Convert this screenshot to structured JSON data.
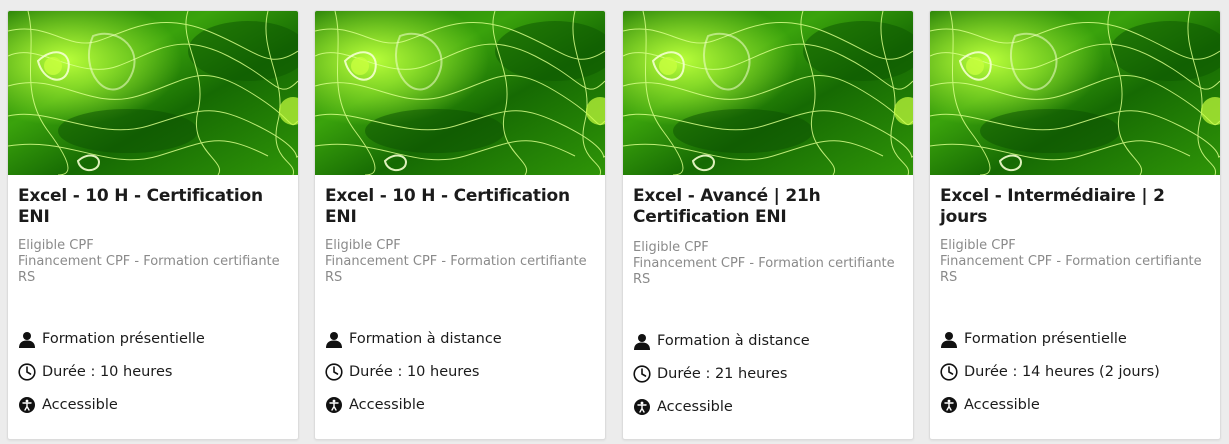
{
  "accent_green": "#4caf10",
  "cards": [
    {
      "title": "Excel - 10 H - Certification ENI",
      "desc": [
        "Eligible CPF",
        "Financement CPF - Formation certifiante",
        "RS"
      ],
      "mode": "Formation présentielle",
      "mode_icon": "person-icon",
      "duration": "Durée : 10 heures",
      "accessible": "Accessible"
    },
    {
      "title": "Excel - 10 H - Certification ENI",
      "desc": [
        "Eligible CPF",
        "Financement CPF - Formation certifiante",
        "RS"
      ],
      "mode": "Formation à distance",
      "mode_icon": "person-icon",
      "duration": "Durée : 10 heures",
      "accessible": "Accessible"
    },
    {
      "title": "Excel - Avancé | 21h Certification ENI",
      "desc": [
        "Eligible CPF",
        "Financement CPF - Formation certifiante",
        "RS"
      ],
      "mode": "Formation à distance",
      "mode_icon": "person-icon",
      "duration": "Durée : 21 heures",
      "accessible": "Accessible"
    },
    {
      "title": "Excel - Intermédiaire | 2 jours",
      "desc": [
        "Eligible CPF",
        "Financement CPF - Formation certifiante",
        "RS"
      ],
      "mode": "Formation présentielle",
      "mode_icon": "person-icon",
      "duration": "Durée : 14 heures (2 jours)",
      "accessible": "Accessible"
    }
  ]
}
